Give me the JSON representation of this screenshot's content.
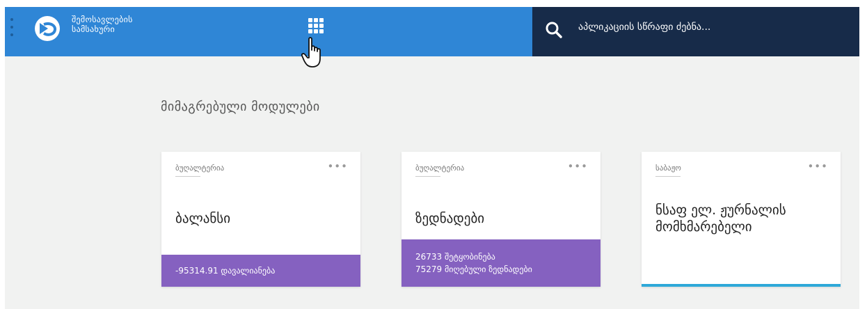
{
  "header": {
    "brand_line1": "შემოსავლების",
    "brand_line2": "სამსახური",
    "search_placeholder": "აპლიკაციის სწრაფი ძებნა...",
    "colors": {
      "bar_blue": "#2f86d6",
      "bar_dark": "#172b49"
    }
  },
  "main": {
    "section_title": "მიმაგრებული მოდულები",
    "cards": [
      {
        "category": "ბუღალტერია",
        "title": "ბალანსი",
        "footer": [
          "-95314.91 დავალიანება"
        ]
      },
      {
        "category": "ბუღალტერია",
        "title": "ზედნადები",
        "footer": [
          "26733 შეტყობინება",
          "75279 მიღებული ზედნადები"
        ]
      },
      {
        "category": "საბაჟო",
        "title_line1": "ნსაფ ელ. ჟურნალის",
        "title_line2": "მომხმარებელი"
      }
    ],
    "more_label": "•••",
    "colors": {
      "footer_purple": "#8561c0",
      "accent_blue": "#2ea8d8"
    }
  },
  "icons": [
    "kebab-icon",
    "logo-icon",
    "apps-grid-icon",
    "hand-cursor-icon",
    "search-icon"
  ]
}
